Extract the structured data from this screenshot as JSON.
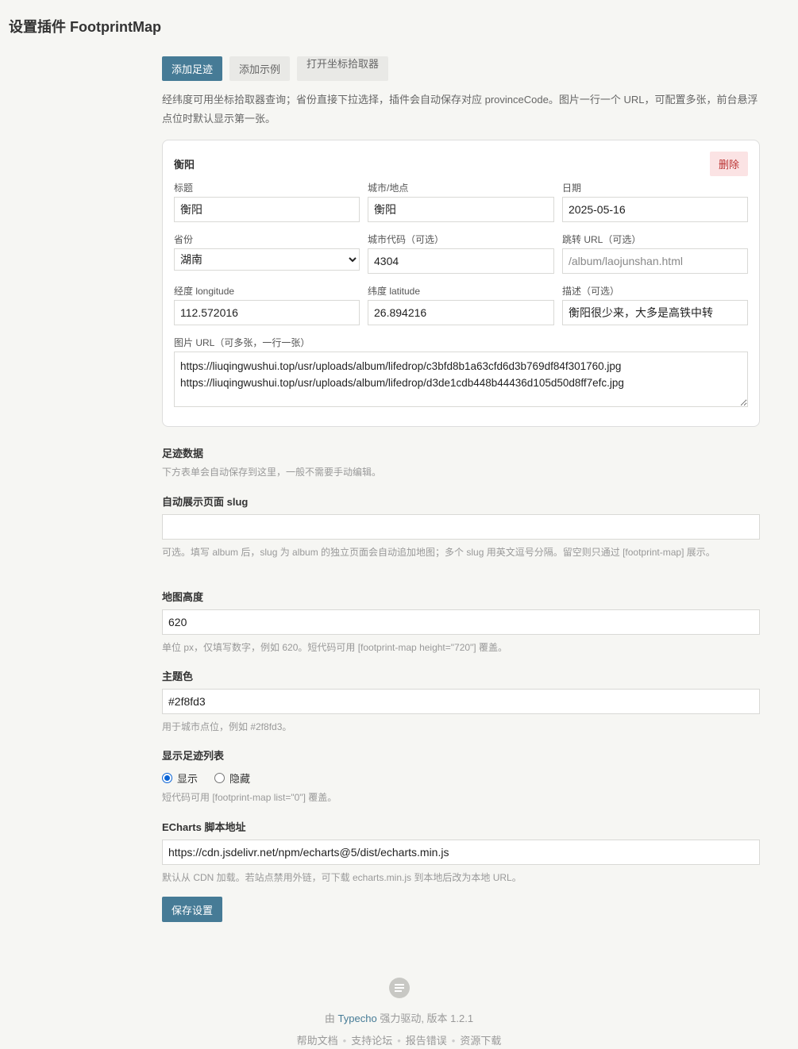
{
  "page_title": "设置插件 FootprintMap",
  "toolbar": {
    "add_footprint": "添加足迹",
    "add_example": "添加示例",
    "open_picker": "打开坐标拾取器"
  },
  "intro": "经纬度可用坐标拾取器查询；省份直接下拉选择，插件会自动保存对应 provinceCode。图片一行一个 URL，可配置多张，前台悬浮点位时默认显示第一张。",
  "card": {
    "title": "衡阳",
    "delete_label": "删除",
    "fields": {
      "title_label": "标题",
      "title_value": "衡阳",
      "city_label": "城市/地点",
      "city_value": "衡阳",
      "date_label": "日期",
      "date_value": "2025-05-16",
      "province_label": "省份",
      "province_value": "湖南",
      "city_code_label": "城市代码（可选）",
      "city_code_value": "4304",
      "link_label": "跳转 URL（可选）",
      "link_placeholder": "/album/laojunshan.html",
      "lng_label": "经度 longitude",
      "lng_value": "112.572016",
      "lat_label": "纬度 latitude",
      "lat_value": "26.894216",
      "desc_label": "描述（可选）",
      "desc_value": "衡阳很少来，大多是高铁中转"
    },
    "images_label": "图片 URL（可多张，一行一张）",
    "images_value": "https://liuqingwushui.top/usr/uploads/album/lifedrop/c3bfd8b1a63cfd6d3b769df84f301760.jpg\nhttps://liuqingwushui.top/usr/uploads/album/lifedrop/d3de1cdb448b44436d105d50d8ff7efc.jpg"
  },
  "footprint_data": {
    "title": "足迹数据",
    "desc": "下方表单会自动保存到这里，一般不需要手动编辑。"
  },
  "slug": {
    "title": "自动展示页面 slug",
    "value": "",
    "desc": "可选。填写 album 后，slug 为 album 的独立页面会自动追加地图；多个 slug 用英文逗号分隔。留空则只通过 [footprint-map] 展示。"
  },
  "map_height": {
    "title": "地图高度",
    "value": "620",
    "desc": "单位 px，仅填写数字，例如 620。短代码可用 [footprint-map height=\"720\"] 覆盖。"
  },
  "theme_color": {
    "title": "主题色",
    "value": "#2f8fd3",
    "desc": "用于城市点位，例如 #2f8fd3。"
  },
  "show_list": {
    "title": "显示足迹列表",
    "option_show": "显示",
    "option_hide": "隐藏",
    "selected": "显示",
    "desc": "短代码可用 [footprint-map list=\"0\"] 覆盖。"
  },
  "echarts": {
    "title": "ECharts 脚本地址",
    "value": "https://cdn.jsdelivr.net/npm/echarts@5/dist/echarts.min.js",
    "desc": "默认从 CDN 加载。若站点禁用外链，可下载 echarts.min.js 到本地后改为本地 URL。"
  },
  "save_label": "保存设置",
  "footer": {
    "powered_prefix": "由",
    "powered_link": "Typecho",
    "powered_suffix": "强力驱动, 版本 1.2.1",
    "links": [
      "帮助文档",
      "支持论坛",
      "报告错误",
      "资源下载"
    ]
  },
  "colors": {
    "primary": "#467b96",
    "background": "#f6f6f3",
    "danger_bg": "#fbe3e4"
  }
}
